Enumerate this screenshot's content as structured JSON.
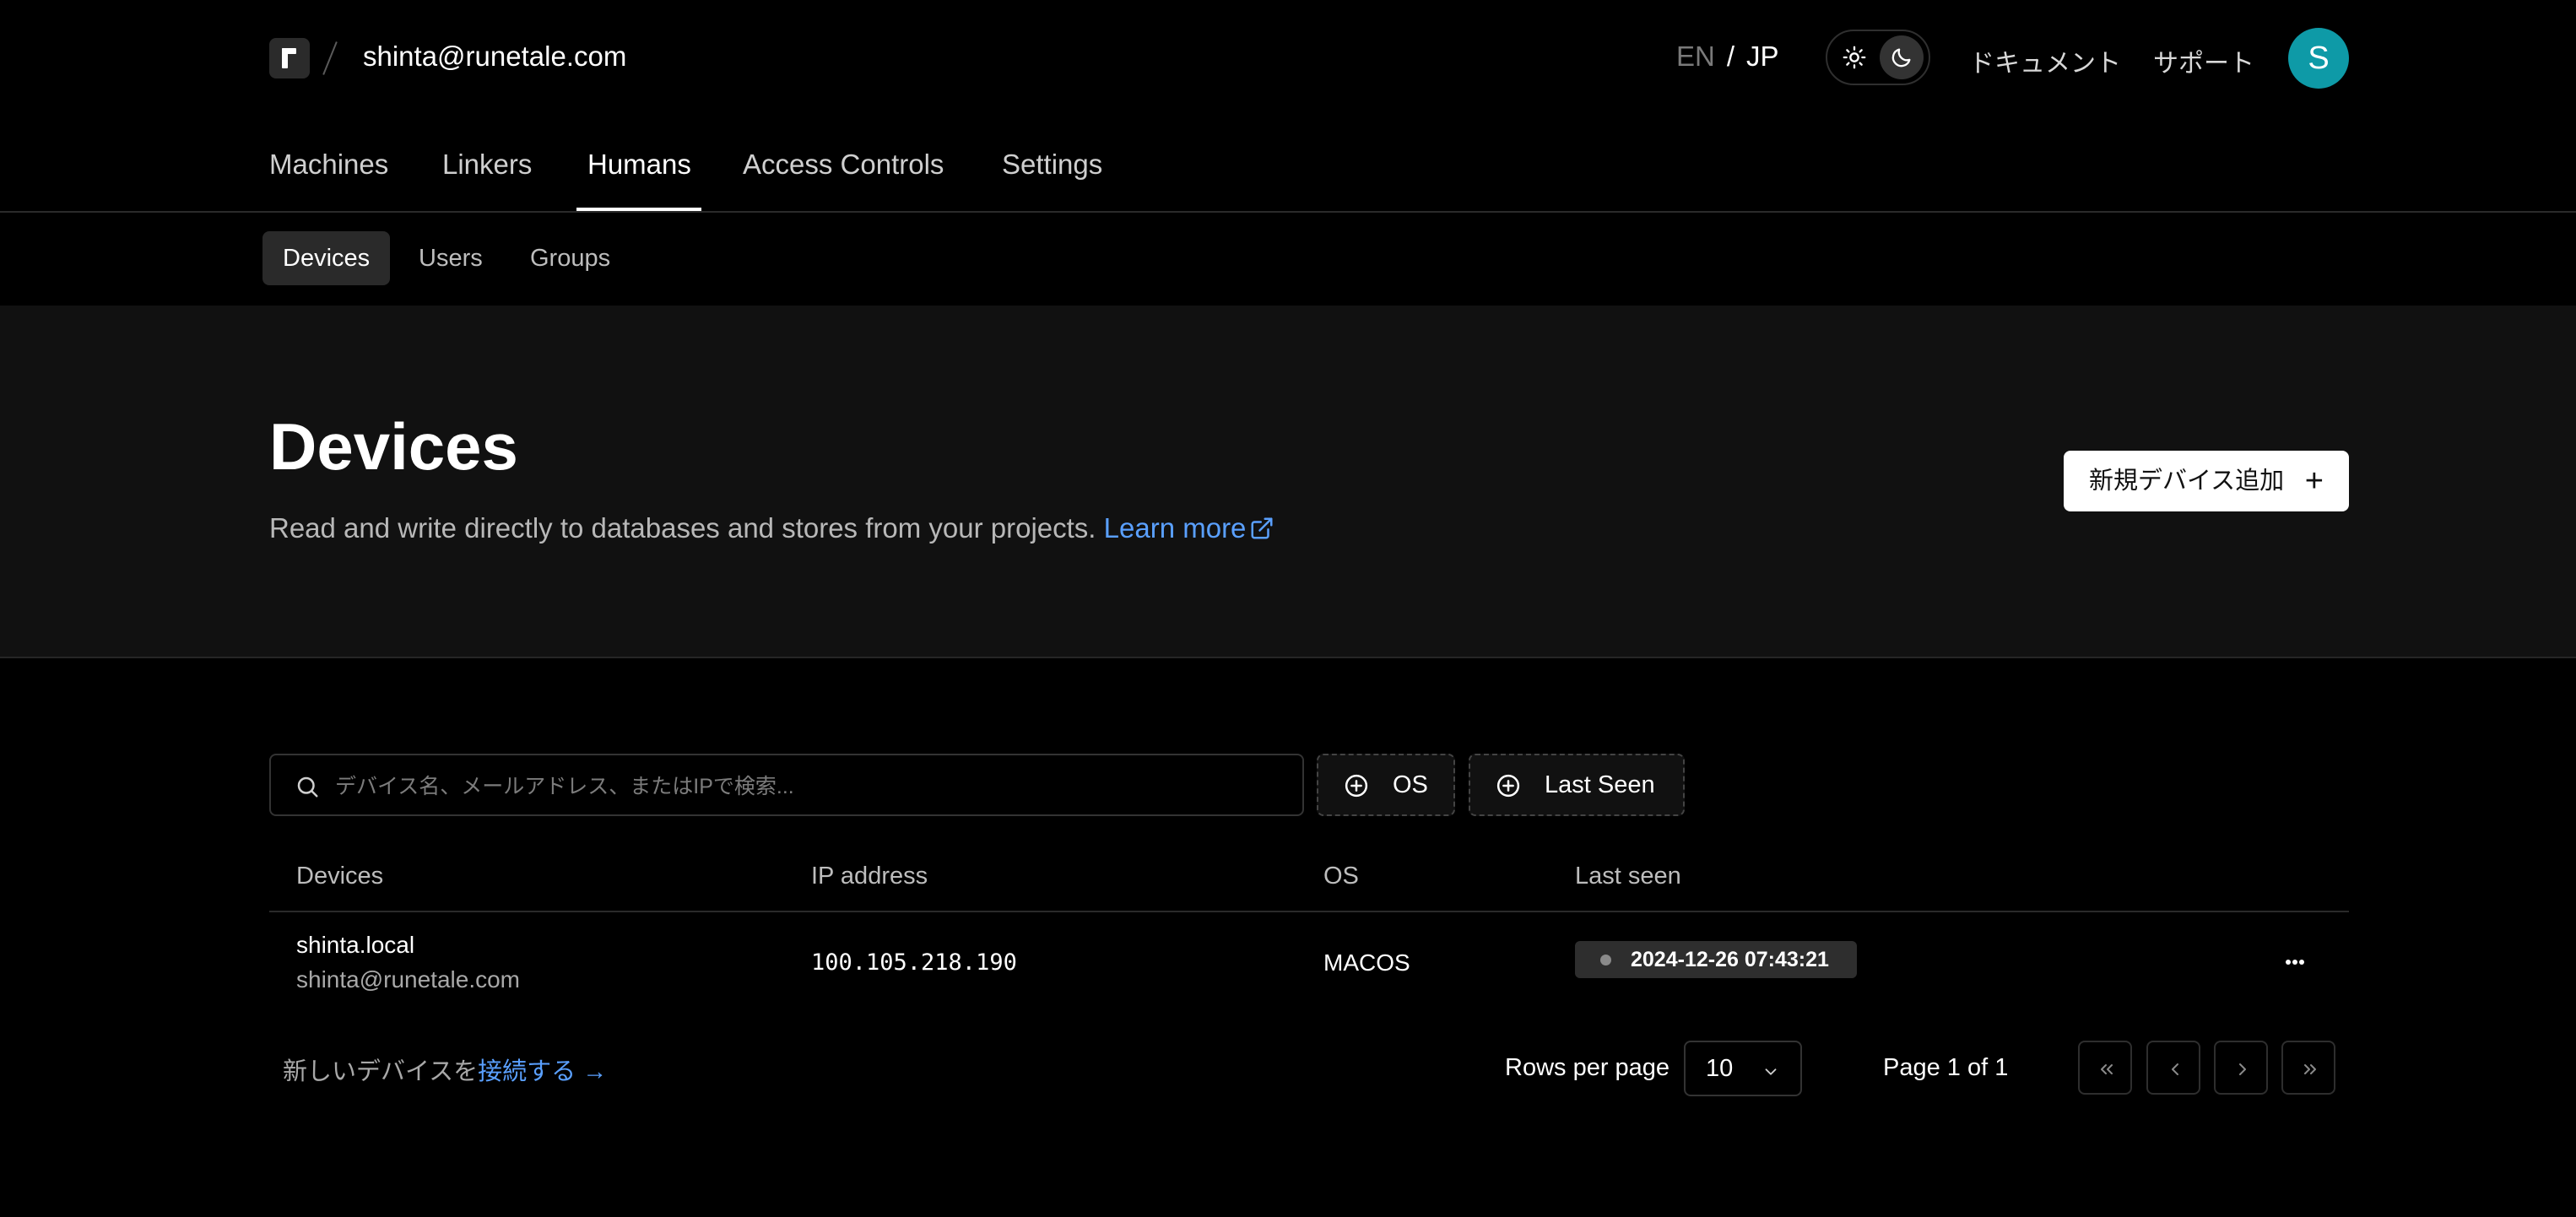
{
  "header": {
    "account": "shinta@runetale.com",
    "lang_en": "EN",
    "lang_sep": "/",
    "lang_jp": "JP",
    "docs_link": "ドキュメント",
    "support_link": "サポート",
    "avatar_initial": "S"
  },
  "main_nav": {
    "tabs": [
      {
        "label": "Machines"
      },
      {
        "label": "Linkers"
      },
      {
        "label": "Humans"
      },
      {
        "label": "Access Controls"
      },
      {
        "label": "Settings"
      }
    ],
    "active": "Humans"
  },
  "sub_nav": {
    "tabs": [
      {
        "label": "Devices"
      },
      {
        "label": "Users"
      },
      {
        "label": "Groups"
      }
    ],
    "active": "Devices"
  },
  "page": {
    "title": "Devices",
    "description": "Read and write directly to databases and stores from your projects.",
    "learn_more": "Learn more",
    "add_button": "新規デバイス追加",
    "add_icon": "+"
  },
  "filters": {
    "search_placeholder": "デバイス名、メールアドレス、またはIPで検索...",
    "os_filter": "OS",
    "last_seen_filter": "Last Seen"
  },
  "table": {
    "columns": [
      "Devices",
      "IP address",
      "OS",
      "Last seen"
    ],
    "rows": [
      {
        "device_name": "shinta.local",
        "device_email": "shinta@runetale.com",
        "ip": "100.105.218.190",
        "os": "MACOS",
        "last_seen": "2024-12-26 07:43:21"
      }
    ]
  },
  "footer": {
    "connect_prefix": "新しいデバイスを",
    "connect_link": "接続する →",
    "rows_per_page_label": "Rows per page",
    "rows_per_page_value": "10",
    "page_info": "Page 1 of 1"
  },
  "colors": {
    "accent_link": "#5aa0ff",
    "avatar": "#0e9aa7",
    "background": "#000000",
    "band": "#111111"
  }
}
